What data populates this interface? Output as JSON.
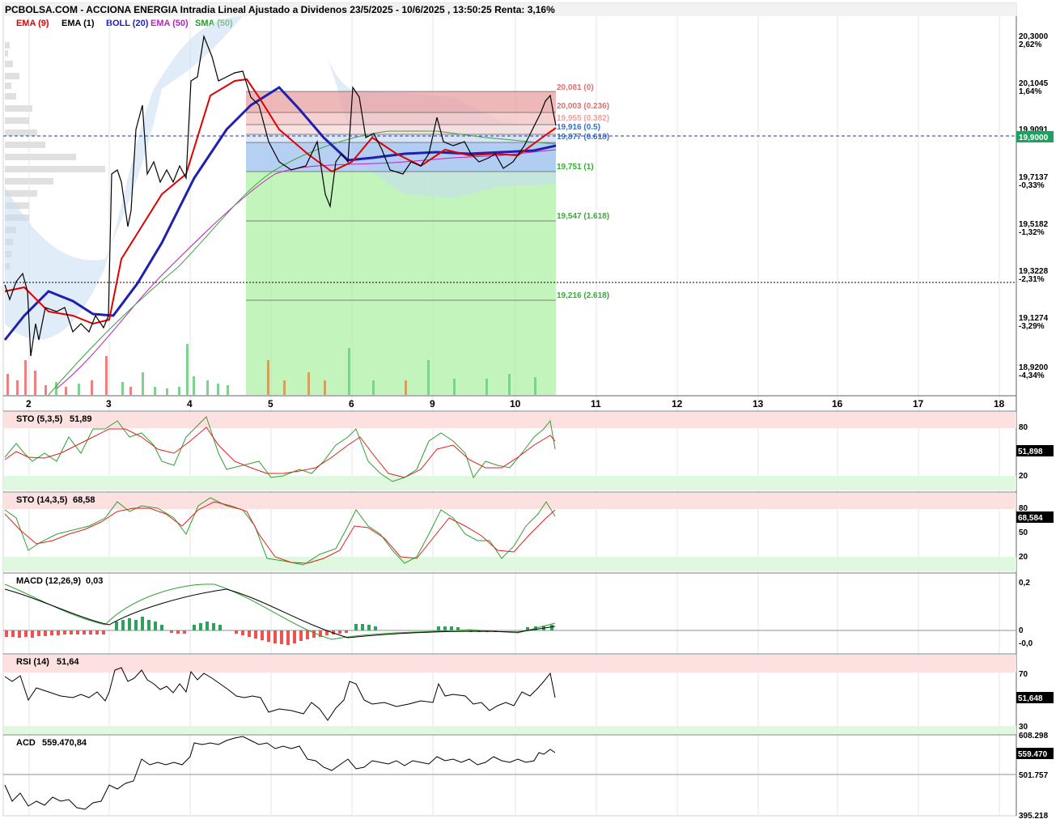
{
  "header": {
    "title": "PCBOLSA.COM - ACCIONA ENERGIA Intradia Lineal Ajustado a Dividenos 23/5/2025 - 10/6/2025 , 13:50:25 Renta: 3,16%"
  },
  "legend": [
    {
      "label": "EMA (9)",
      "color": "#e00000"
    },
    {
      "label": "EMA (1)",
      "color": "#000000"
    },
    {
      "label": "BOLL (20)",
      "color": "#2020c0"
    },
    {
      "label": "EMA (50)",
      "color": "#c020c0"
    },
    {
      "label": "SMA (50)",
      "color": "#20a020"
    }
  ],
  "price_axis": {
    "ticks": [
      {
        "value": "20,3000",
        "pct": "2,62%",
        "pct_color": "#20a080"
      },
      {
        "value": "20,1045",
        "pct": "1,64%",
        "pct_color": "#20a080"
      },
      {
        "value": "19,9091",
        "pct": "",
        "pct_color": "#20a080"
      },
      {
        "value": "19,7137",
        "pct": "-0,33%",
        "pct_color": "#e03030"
      },
      {
        "value": "19,5182",
        "pct": "-1,32%",
        "pct_color": "#e03030"
      },
      {
        "value": "19,3228",
        "pct": "-2,31%",
        "pct_color": "#e03030"
      },
      {
        "value": "19,1274",
        "pct": "-3,29%",
        "pct_color": "#e03030"
      },
      {
        "value": "18,9200",
        "pct": "-4,34%",
        "pct_color": "#e03030"
      }
    ],
    "current": "19,9000"
  },
  "fib_levels": [
    {
      "label": "20,081 (0)",
      "color": "#e07070"
    },
    {
      "label": "20,003 (0.236)",
      "color": "#e07070"
    },
    {
      "label": "19,955 (0.382)",
      "color": "#f0a0a0"
    },
    {
      "label": "19,916 (0.5)",
      "color": "#3070d0"
    },
    {
      "label": "19,877 (0.618)",
      "color": "#3070d0"
    },
    {
      "label": "19,751 (1)",
      "color": "#30b030"
    },
    {
      "label": "19,547 (1.618)",
      "color": "#30b030"
    },
    {
      "label": "19,216 (2.618)",
      "color": "#30b030"
    }
  ],
  "x_axis": [
    "2",
    "3",
    "4",
    "5",
    "6",
    "9",
    "10",
    "11",
    "12",
    "13",
    "16",
    "17",
    "18"
  ],
  "sto1": {
    "label": "STO (5,3,5)",
    "value": "51,89",
    "box": "51,898",
    "axis": [
      "80",
      "20"
    ]
  },
  "sto2": {
    "label": "STO (14,3,5)",
    "value": "68,58",
    "box": "68,584",
    "axis": [
      "80",
      "50",
      "20"
    ]
  },
  "macd": {
    "label": "MACD (12,26,9)",
    "value": "0,03",
    "axis": [
      "0,2",
      "0",
      "-0,0"
    ]
  },
  "rsi": {
    "label": "RSI (14)",
    "value": "51,64",
    "box": "51,648",
    "axis": [
      "70",
      "30"
    ]
  },
  "acd": {
    "label": "ACD",
    "value": "559.470,84",
    "box": "559.470",
    "axis": [
      "608.298",
      "501.757",
      "395.218"
    ]
  },
  "chart_data": {
    "type": "line",
    "title": "PCBOLSA.COM - ACCIONA ENERGIA Intradia Lineal Ajustado a Dividenos 23/5/2025 - 10/6/2025 , 13:50:25 Renta: 3,16%",
    "x": [
      "2",
      "3",
      "4",
      "5",
      "6",
      "9",
      "10"
    ],
    "price_close": [
      19.29,
      19.14,
      20.28,
      19.78,
      20.02,
      19.88,
      19.9
    ],
    "series": [
      {
        "name": "EMA (1)",
        "values": [
          19.29,
          19.14,
          20.28,
          19.78,
          20.02,
          19.88,
          19.9
        ]
      },
      {
        "name": "EMA (9)",
        "values": [
          19.21,
          19.13,
          20.05,
          19.91,
          19.8,
          19.79,
          19.9
        ]
      },
      {
        "name": "BOLL (20)",
        "values": [
          19.2,
          19.13,
          19.82,
          20.0,
          19.8,
          19.8,
          19.86
        ]
      }
    ],
    "fibonacci": [
      20.081,
      20.003,
      19.955,
      19.916,
      19.877,
      19.751,
      19.547,
      19.216
    ],
    "ylim": [
      18.92,
      20.3
    ]
  }
}
